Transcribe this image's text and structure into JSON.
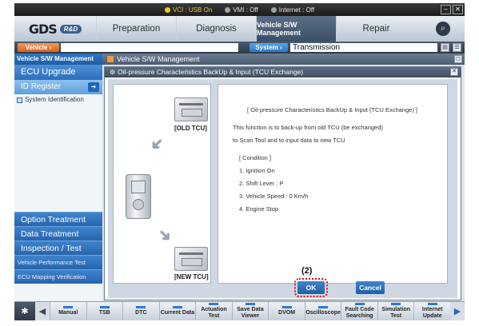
{
  "status": {
    "vci": "VCI : USB On",
    "vmi": "VMI : Off",
    "internet": "Internet : Off",
    "minimize_icon": "minimize-icon",
    "close_icon": "close-icon"
  },
  "nav": {
    "logo": "GDS",
    "logo_badge": "R&D",
    "tabs": [
      "Preparation",
      "Diagnosis",
      "Vehicle S/W Management",
      "Repair"
    ],
    "active_tab": "Vehicle S/W Management"
  },
  "vehicle_bar": {
    "vehicle_label": "Vehicle",
    "vehicle_value": "",
    "system_label": "System",
    "system_value": "Transmission"
  },
  "sidebar": {
    "header": "Vehicle S/W Management",
    "ecu_upgrade": "ECU Upgrade",
    "id_register": "ID Register",
    "system_identification": "System Identification",
    "categories": [
      "Option Treatment",
      "Data Treatment",
      "Inspection / Test"
    ],
    "sub_items": [
      "Vehicle Performance Test",
      "ECU Mapping Verification"
    ]
  },
  "main": {
    "header": "Vehicle S/W Management",
    "dialog_title": "Oil-pressure Characteristics BackUp & Input (TCU Exchange)",
    "old_tcu_label": "[OLD TCU]",
    "new_tcu_label": "[NEW TCU]",
    "info": {
      "title": "[ Oil-pressure Characteristics BackUp & Input (TCU Exchange) ]",
      "line1": "This function is to back-up from old TCU (be exchanged)",
      "line2": "to Scan Tool and to input data to new TCU",
      "condition_header": "[ Condition ]",
      "conditions": [
        "1. Ignition On",
        "2. Shift Lever : P",
        "3. Vehicle Speed : 0 Km/h",
        "4. Engine Stop"
      ]
    },
    "ok_label": "OK",
    "cancel_label": "Cancel",
    "callout": "(2)"
  },
  "toolbar": {
    "items": [
      "Manual",
      "TSB",
      "DTC",
      "Current Data",
      "Actuation Test",
      "Save Data Viewer",
      "DVOM",
      "Oscilloscope",
      "Fault Code Searching",
      "Simulation Test",
      "Internet Update"
    ]
  }
}
